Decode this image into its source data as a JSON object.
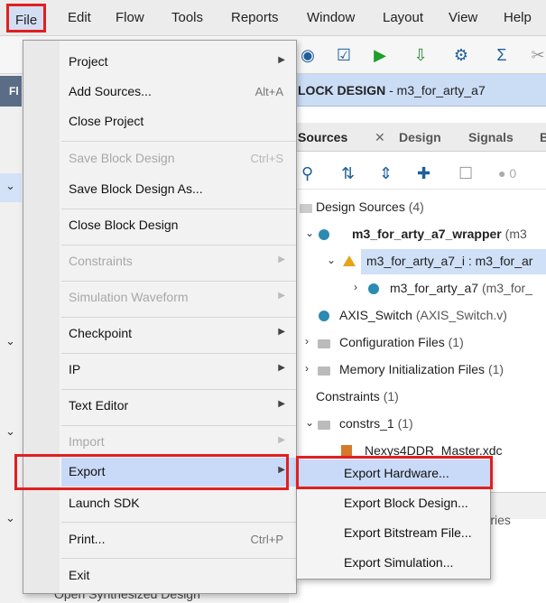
{
  "menubar": {
    "items": [
      "File",
      "Edit",
      "Flow",
      "Tools",
      "Reports",
      "Window",
      "Layout",
      "View",
      "Help"
    ]
  },
  "left": {
    "header": "Fl",
    "bottom_text": "Open Synthesized Design"
  },
  "block_design": {
    "prefix": "LOCK DESIGN",
    "name": " - m3_for_arty_a7"
  },
  "sources": {
    "tabs": [
      "Sources",
      "Design",
      "Signals",
      "B"
    ],
    "badge_count": "0",
    "tree": [
      {
        "label": "Design Sources",
        "extra": " (4)"
      },
      {
        "label": "m3_for_arty_a7_wrapper",
        "extra": " (m3"
      },
      {
        "label": "m3_for_arty_a7_i : m3_for_ar",
        "extra": ""
      },
      {
        "label": "m3_for_arty_a7",
        "extra": " (m3_for_"
      },
      {
        "label": "AXIS_Switch",
        "extra": " (AXIS_Switch.v)"
      },
      {
        "label": "Configuration Files",
        "extra": " (1)"
      },
      {
        "label": "Memory Initialization Files",
        "extra": " (1)"
      },
      {
        "label": "Constraints",
        "extra": " (1)"
      },
      {
        "label": "constrs_1",
        "extra": " (1)"
      },
      {
        "label": "Nexys4DDR_Master.xdc",
        "extra": ""
      }
    ],
    "libraries_tab": "ibraries"
  },
  "file_menu": {
    "project": "Project",
    "add_sources": "Add Sources...",
    "add_sources_shortcut": "Alt+A",
    "close_project": "Close Project",
    "save_block_design": "Save Block Design",
    "save_block_design_shortcut": "Ctrl+S",
    "save_block_design_as": "Save Block Design As...",
    "close_block_design": "Close Block Design",
    "constraints": "Constraints",
    "simulation_waveform": "Simulation Waveform",
    "checkpoint": "Checkpoint",
    "ip": "IP",
    "text_editor": "Text Editor",
    "import": "Import",
    "export": "Export",
    "launch_sdk": "Launch SDK",
    "print": "Print...",
    "print_shortcut": "Ctrl+P",
    "exit": "Exit"
  },
  "export_submenu": {
    "items": [
      "Export Hardware...",
      "Export Block Design...",
      "Export Bitstream File...",
      "Export Simulation..."
    ]
  }
}
